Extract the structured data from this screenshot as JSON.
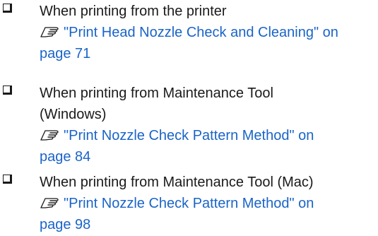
{
  "items": [
    {
      "heading": [
        "When printing from the printer"
      ],
      "link_lines": [
        "\"Print Head Nozzle Check and Cleaning\" on",
        "page 71"
      ]
    },
    {
      "heading": [
        "When printing from Maintenance Tool",
        "(Windows)"
      ],
      "link_lines": [
        "\"Print Nozzle Check Pattern Method\" on",
        "page 84"
      ]
    },
    {
      "heading": [
        "When printing from Maintenance Tool (Mac)"
      ],
      "link_lines": [
        "\"Print Nozzle Check Pattern Method\" on",
        "page 98"
      ]
    }
  ],
  "icons": {
    "checkbox": "checkbox-icon",
    "reference": "reference-hand-icon"
  },
  "colors": {
    "text": "#1a1a1a",
    "link": "#1a64c8"
  }
}
